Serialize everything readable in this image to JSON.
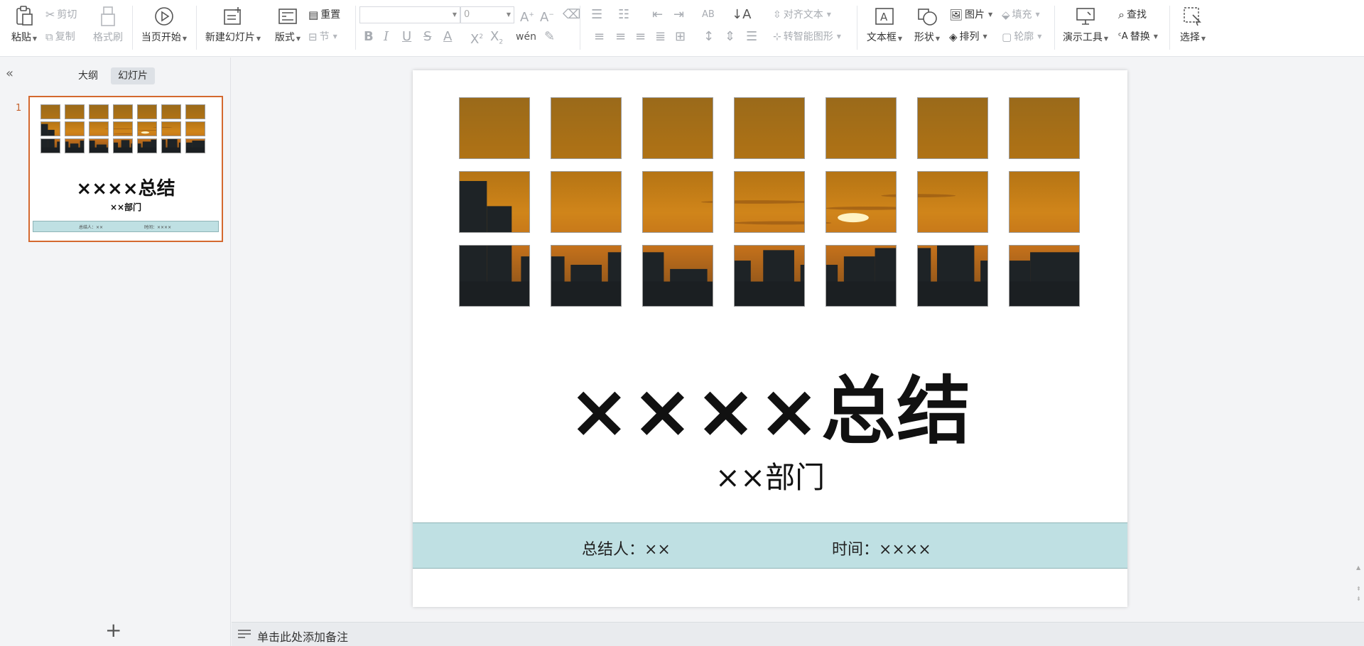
{
  "ribbon": {
    "paste": "粘贴",
    "cut": "剪切",
    "copy": "复制",
    "format_painter": "格式刷",
    "play_from_current": "当页开始",
    "new_slide": "新建幻灯片",
    "layout": "版式",
    "reset": "重置",
    "section": "节",
    "font_size_value": "0",
    "align_text": "对齐文本",
    "convert_smartart": "转智能图形",
    "text_box": "文本框",
    "shapes": "形状",
    "picture": "图片",
    "fill": "填充",
    "arrange": "排列",
    "outline": "轮廓",
    "present_tools": "演示工具",
    "find": "查找",
    "replace": "替换",
    "select": "选择"
  },
  "panel": {
    "tab_outline": "大纲",
    "tab_slides": "幻灯片",
    "slide_number": "1",
    "add_slide": "+"
  },
  "slide": {
    "title": "××××总结",
    "subtitle": "××部门",
    "summarizer": "总结人：××",
    "time": "时间：××××"
  },
  "thumb": {
    "title": "××××总结",
    "subtitle": "××部门",
    "summarizer": "总结人：××",
    "time": "时间：××××"
  },
  "notes": {
    "placeholder": "单击此处添加备注"
  },
  "colors": {
    "band": "#bfe0e3",
    "thumb_border": "#d4692f",
    "sky_orange": "#c98417"
  }
}
